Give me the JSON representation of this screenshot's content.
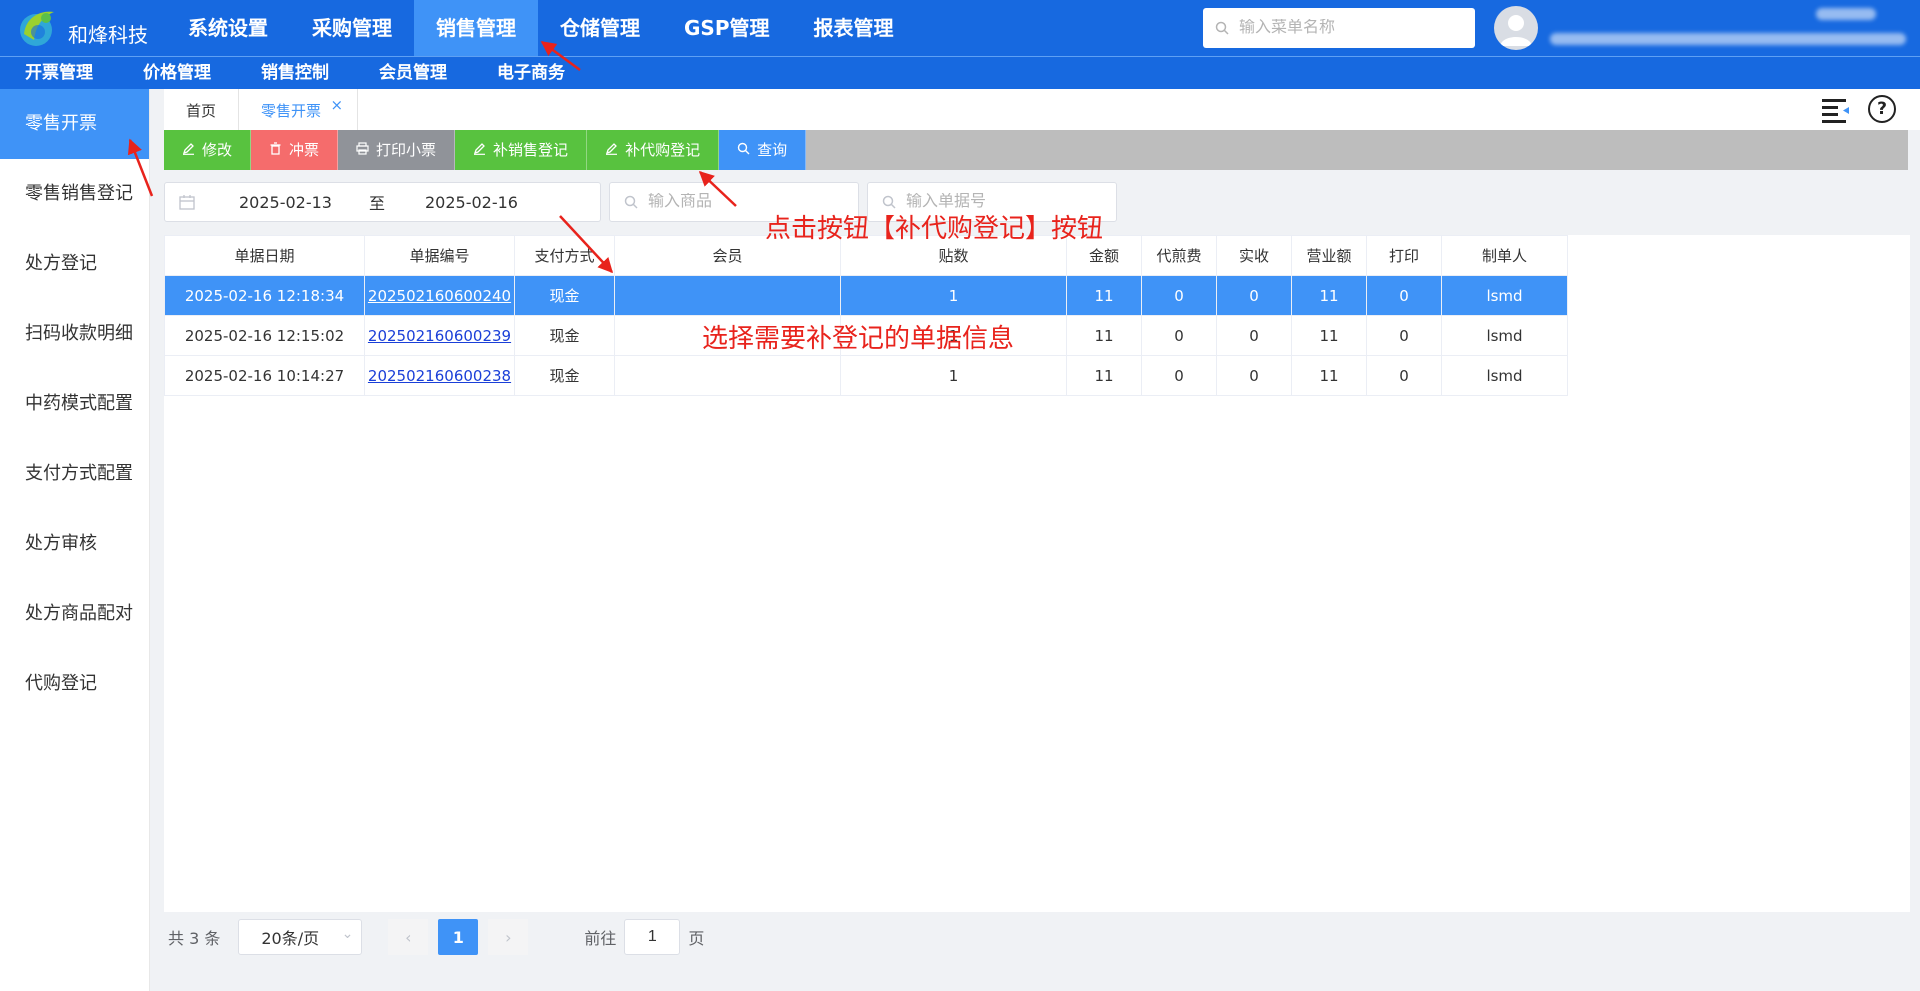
{
  "brand": {
    "name": "和烽科技"
  },
  "main_nav": [
    {
      "label": "系统设置",
      "active": false
    },
    {
      "label": "采购管理",
      "active": false
    },
    {
      "label": "销售管理",
      "active": true
    },
    {
      "label": "仓储管理",
      "active": false
    },
    {
      "label": "GSP管理",
      "active": false
    },
    {
      "label": "报表管理",
      "active": false
    }
  ],
  "menu_search": {
    "placeholder": "输入菜单名称",
    "icon": "search-icon"
  },
  "sub_nav": [
    "开票管理",
    "价格管理",
    "销售控制",
    "会员管理",
    "电子商务"
  ],
  "sidebar": [
    {
      "label": "零售开票",
      "active": true
    },
    {
      "label": "零售销售登记",
      "active": false
    },
    {
      "label": "处方登记",
      "active": false
    },
    {
      "label": "扫码收款明细",
      "active": false
    },
    {
      "label": "中药模式配置",
      "active": false
    },
    {
      "label": "支付方式配置",
      "active": false
    },
    {
      "label": "处方审核",
      "active": false
    },
    {
      "label": "处方商品配对",
      "active": false
    },
    {
      "label": "代购登记",
      "active": false
    }
  ],
  "tabs": [
    {
      "label": "首页",
      "active": false
    },
    {
      "label": "零售开票",
      "active": true,
      "close": "×"
    }
  ],
  "toolbar": [
    {
      "label": "修改",
      "color": "#58c23f",
      "icon": "edit-icon"
    },
    {
      "label": "冲票",
      "color": "#f56c6c",
      "icon": "trash-icon"
    },
    {
      "label": "打印小票",
      "color": "#909399",
      "icon": "printer-icon"
    },
    {
      "label": "补销售登记",
      "color": "#58c23f",
      "icon": "edit-icon"
    },
    {
      "label": "补代购登记",
      "color": "#58c23f",
      "icon": "edit-icon"
    },
    {
      "label": "查询",
      "color": "#3f93f7",
      "icon": "search-icon"
    }
  ],
  "filters": {
    "date_from": "2025-02-13",
    "date_sep": "至",
    "date_to": "2025-02-16",
    "product_placeholder": "输入商品",
    "docno_placeholder": "输入单据号"
  },
  "table": {
    "columns": [
      "单据日期",
      "单据编号",
      "支付方式",
      "会员",
      "贴数",
      "金额",
      "代煎费",
      "实收",
      "营业额",
      "打印",
      "制单人"
    ],
    "rows": [
      {
        "date": "2025-02-16 12:18:34",
        "no": "202502160600240",
        "pay": "现金",
        "member": "",
        "tie": "1",
        "amount": "11",
        "fee": "0",
        "paid": "0",
        "revenue": "11",
        "print": "0",
        "maker": "lsmd",
        "selected": true
      },
      {
        "date": "2025-02-16 12:15:02",
        "no": "202502160600239",
        "pay": "现金",
        "member": "",
        "tie": "1",
        "amount": "11",
        "fee": "0",
        "paid": "0",
        "revenue": "11",
        "print": "0",
        "maker": "lsmd",
        "selected": false
      },
      {
        "date": "2025-02-16 10:14:27",
        "no": "202502160600238",
        "pay": "现金",
        "member": "",
        "tie": "1",
        "amount": "11",
        "fee": "0",
        "paid": "0",
        "revenue": "11",
        "print": "0",
        "maker": "lsmd",
        "selected": false
      }
    ]
  },
  "pager": {
    "total": "共 3 条",
    "page_size": "20条/页",
    "current": "1",
    "goto_label": "前往",
    "goto_value": "1",
    "page_suffix": "页"
  },
  "annotations": {
    "click_button": "点击按钮【补代购登记】按钮",
    "select_row": "选择需要补登记的单据信息"
  },
  "colors": {
    "nav_blue": "#1769e0",
    "active_blue": "#3f93f7",
    "annotation_red": "#e8231c"
  }
}
